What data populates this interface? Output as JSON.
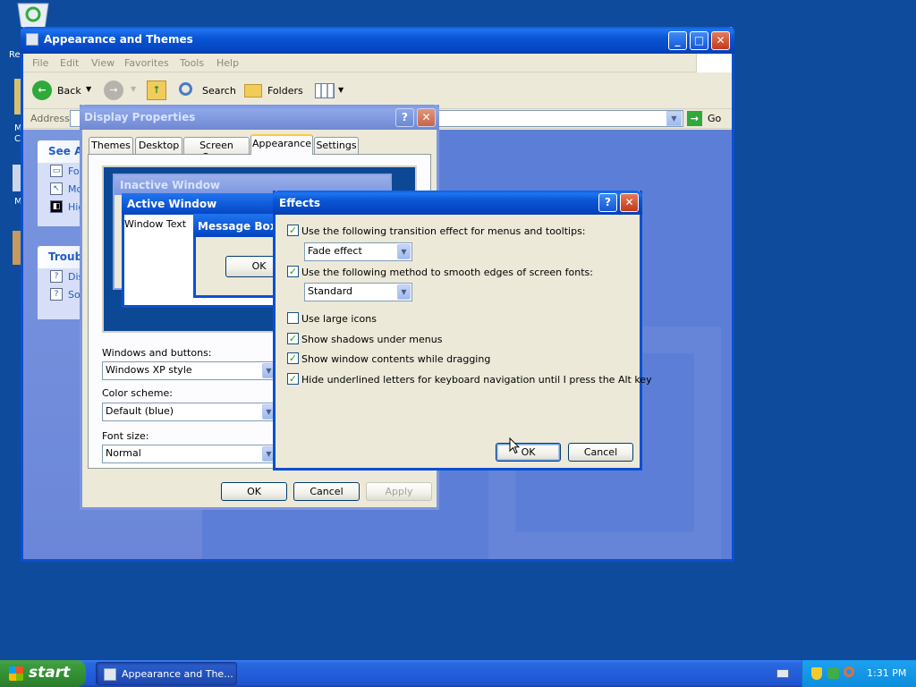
{
  "desktop": {
    "icon_labels": [
      "Re",
      "M",
      "C",
      "M"
    ]
  },
  "explorer": {
    "title": "Appearance and Themes",
    "menu": [
      "File",
      "Edit",
      "View",
      "Favorites",
      "Tools",
      "Help"
    ],
    "toolbar": {
      "back": "Back",
      "search": "Search",
      "folders": "Folders"
    },
    "address_label": "Address",
    "go_label": "Go",
    "see_also": {
      "title": "See Als",
      "items": [
        "For",
        "Mo",
        "Hig"
      ]
    },
    "troubleshooters": {
      "title": "Troubl",
      "items": [
        "Dis",
        "So"
      ]
    }
  },
  "display_properties": {
    "title": "Display Properties",
    "tabs": [
      "Themes",
      "Desktop",
      "Screen Saver",
      "Appearance",
      "Settings"
    ],
    "active_tab": "Appearance",
    "preview": {
      "inactive_title": "Inactive Window",
      "active_title": "Active Window",
      "window_text": "Window Text",
      "message_box_title": "Message Box",
      "ok": "OK"
    },
    "windows_buttons_label": "Windows and buttons:",
    "windows_buttons_value": "Windows XP style",
    "color_scheme_label": "Color scheme:",
    "color_scheme_value": "Default (blue)",
    "font_size_label": "Font size:",
    "font_size_value": "Normal",
    "ok": "OK",
    "cancel": "Cancel",
    "apply": "Apply"
  },
  "effects": {
    "title": "Effects",
    "transition_checkbox": "Use the following transition effect for menus and tooltips:",
    "transition_checked": true,
    "transition_value": "Fade effect",
    "smooth_checkbox": "Use the following method to smooth edges of screen fonts:",
    "smooth_checked": true,
    "smooth_value": "Standard",
    "large_icons": "Use large icons",
    "large_icons_checked": false,
    "shadows": "Show shadows under menus",
    "shadows_checked": true,
    "window_contents": "Show window contents while dragging",
    "window_contents_checked": true,
    "hide_underlined": "Hide underlined letters for keyboard navigation until I press the Alt key",
    "hide_underlined_checked": true,
    "ok": "OK",
    "cancel": "Cancel"
  },
  "taskbar": {
    "start": "start",
    "task_label": "Appearance and The...",
    "clock": "1:31 PM"
  },
  "colors": {
    "desktop": "#0f4b9c",
    "title_active": "#0a56d6",
    "title_inactive": "#7c96e0",
    "dialog_face": "#ece9d8",
    "taskbar": "#245edb",
    "start_green": "#3c9a3c"
  }
}
